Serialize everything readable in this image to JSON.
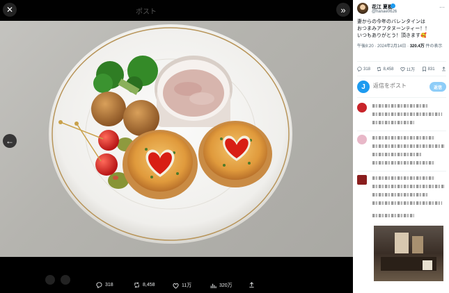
{
  "viewer": {
    "header_title": "ポスト",
    "actions": {
      "replies": "318",
      "reposts": "8,458",
      "likes": "11万",
      "views": "320万"
    }
  },
  "tweet": {
    "author_name": "花江 夏樹",
    "author_handle": "@hanae0626",
    "text": "妻からの今年のバレンタインは\nおつまみアフタヌーンティー！！\nいつもありがとう！頂きます🥰",
    "time": "午後8:20 · 2024年2月14日 · ",
    "views_count": "320.4万",
    "views_label": " 件の表示",
    "stats": {
      "replies": "318",
      "reposts": "8,458",
      "likes": "11万",
      "bookmarks": "831"
    }
  },
  "reply_box": {
    "avatar_letter": "J",
    "placeholder": "返信をポスト",
    "button": "返信"
  },
  "icons": [
    "close-icon",
    "expand-icon",
    "back-arrow-icon",
    "reply-icon",
    "repost-icon",
    "like-icon",
    "views-icon",
    "bookmark-icon",
    "share-icon",
    "more-icon",
    "verified-icon"
  ],
  "colors": {
    "accent": "#1d9bf0",
    "reply_button": "#8ecdf8",
    "text": "#0f1419",
    "secondary_text": "#536471"
  }
}
